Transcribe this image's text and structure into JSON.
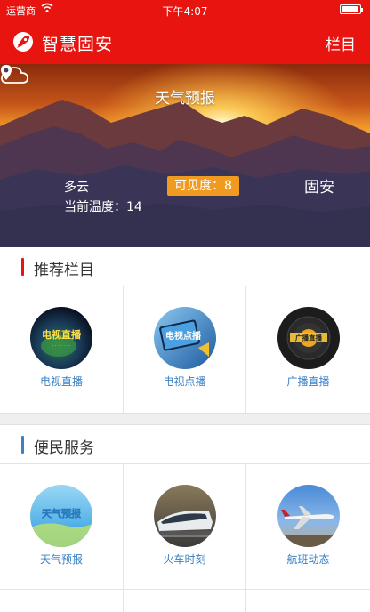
{
  "status_bar": {
    "carrier": "运营商",
    "time": "下午4:07",
    "battery_level": 0.9
  },
  "navbar": {
    "title": "智慧固安",
    "menu_label": "栏目",
    "logo_icon": "rocket-logo-icon"
  },
  "banner": {
    "title": "天气预报",
    "condition": "多云",
    "temp_label": "当前温度：",
    "temp_value": "14",
    "visibility": "可见度：8",
    "location": "固安",
    "weather_icon": "cloud-icon",
    "location_icon": "map-pin-icon"
  },
  "recommended": {
    "title": "推荐栏目",
    "accent": "#e8140f",
    "items": [
      {
        "label": "电视直播",
        "icon": "tv-live-icon",
        "overlay": "电视直播"
      },
      {
        "label": "电视点播",
        "icon": "tv-vod-icon",
        "overlay": "电视点播"
      },
      {
        "label": "广播直播",
        "icon": "radio-live-icon",
        "overlay": "广播直播"
      }
    ]
  },
  "services": {
    "title": "便民服务",
    "accent": "#3b82c4",
    "items": [
      {
        "label": "天气预报",
        "icon": "weather-forecast-icon",
        "overlay": "天气预报"
      },
      {
        "label": "火车时刻",
        "icon": "train-schedule-icon"
      },
      {
        "label": "航班动态",
        "icon": "flight-status-icon"
      }
    ]
  },
  "colors": {
    "brand_red": "#e8140f",
    "link_blue": "#3b82c4",
    "badge_orange": "#f09a20"
  }
}
